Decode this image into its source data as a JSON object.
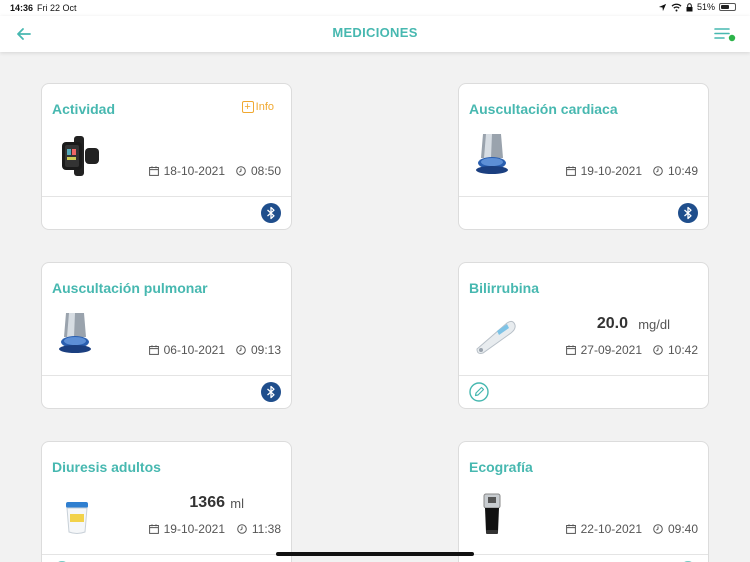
{
  "status_bar": {
    "time": "14:36",
    "date": "Fri 22 Oct",
    "battery": "51%"
  },
  "header": {
    "title": "MEDICIONES"
  },
  "info_label": "Info",
  "cards": [
    {
      "title": "Actividad",
      "date": "18-10-2021",
      "time": "08:50",
      "device_icon": "smartwatch-icon",
      "action_icon": "bluetooth-icon"
    },
    {
      "title": "Auscultación cardiaca",
      "date": "19-10-2021",
      "time": "10:49",
      "device_icon": "stethoscope-icon",
      "action_icon": "bluetooth-icon"
    },
    {
      "title": "Auscultación pulmonar",
      "date": "06-10-2021",
      "time": "09:13",
      "device_icon": "stethoscope-icon",
      "action_icon": "bluetooth-icon"
    },
    {
      "title": "Bilirrubina",
      "value": "20.0",
      "unit": "mg/dl",
      "date": "27-09-2021",
      "time": "10:42",
      "device_icon": "bilirubinometer-icon",
      "action_icon": "pencil-icon"
    },
    {
      "title": "Diuresis adultos",
      "value": "1366",
      "unit": "ml",
      "date": "19-10-2021",
      "time": "11:38",
      "device_icon": "urine-cup-icon",
      "action_icon": "pencil-icon"
    },
    {
      "title": "Ecografía",
      "date": "22-10-2021",
      "time": "09:40",
      "device_icon": "ultrasound-probe-icon",
      "action_icon": "pencil-icon"
    }
  ],
  "colors": {
    "accent": "#47b8b0",
    "info": "#f0a830",
    "bluetooth": "#1f4e8c",
    "background": "#f2f2f2"
  }
}
